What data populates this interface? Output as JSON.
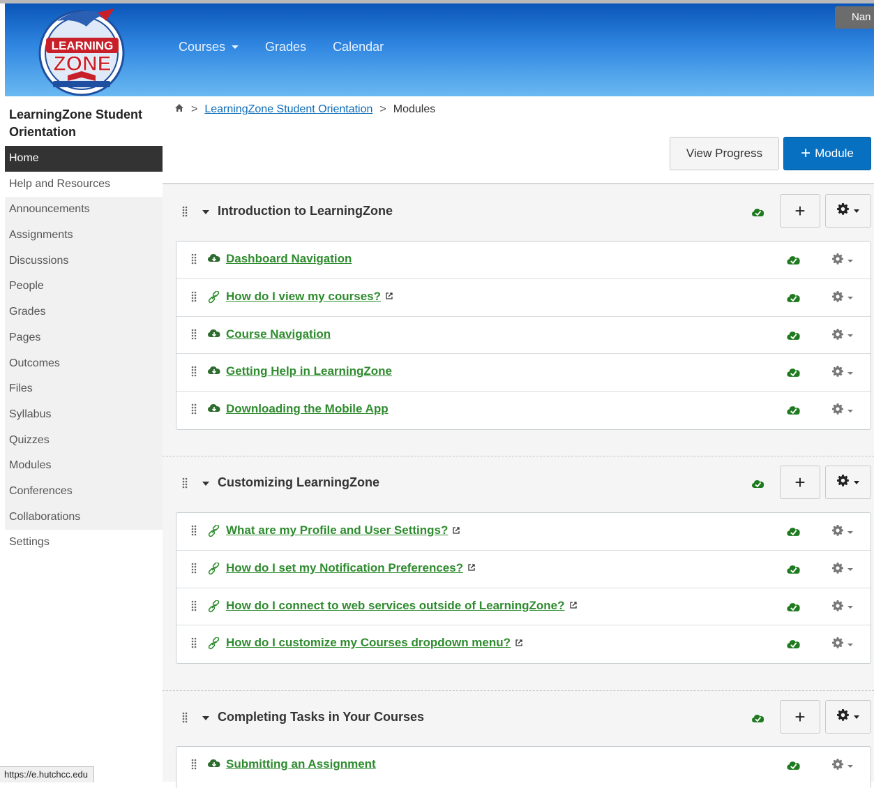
{
  "header": {
    "logo_alt": "LearningZone",
    "nav": [
      {
        "label": "Courses",
        "has_caret": true
      },
      {
        "label": "Grades",
        "has_caret": false
      },
      {
        "label": "Calendar",
        "has_caret": false
      }
    ],
    "user_short": "Nan"
  },
  "sidebar": {
    "course_title": "LearningZone Student Orientation",
    "items": [
      {
        "label": "Home"
      },
      {
        "label": "Help and Resources"
      },
      {
        "label": "Announcements"
      },
      {
        "label": "Assignments"
      },
      {
        "label": "Discussions"
      },
      {
        "label": "People"
      },
      {
        "label": "Grades"
      },
      {
        "label": "Pages"
      },
      {
        "label": "Outcomes"
      },
      {
        "label": "Files"
      },
      {
        "label": "Syllabus"
      },
      {
        "label": "Quizzes"
      },
      {
        "label": "Modules"
      },
      {
        "label": "Conferences"
      },
      {
        "label": "Collaborations"
      },
      {
        "label": "Settings"
      }
    ]
  },
  "breadcrumb": {
    "course": "LearningZone Student Orientation",
    "current": "Modules"
  },
  "actions": {
    "view_progress": "View Progress",
    "add_module": "Module"
  },
  "modules": [
    {
      "title": "Introduction to LearningZone",
      "items": [
        {
          "type": "page",
          "label": "Dashboard Navigation",
          "external": false
        },
        {
          "type": "link",
          "label": "How do I view my courses?",
          "external": true
        },
        {
          "type": "page",
          "label": "Course Navigation",
          "external": false
        },
        {
          "type": "page",
          "label": "Getting Help in LearningZone",
          "external": false
        },
        {
          "type": "page",
          "label": "Downloading the Mobile App",
          "external": false
        }
      ]
    },
    {
      "title": "Customizing LearningZone",
      "items": [
        {
          "type": "link",
          "label": "What are my Profile and User Settings?",
          "external": true
        },
        {
          "type": "link",
          "label": "How do I set my Notification Preferences?",
          "external": true
        },
        {
          "type": "link",
          "label": "How do I connect to web services outside of LearningZone?",
          "external": true
        },
        {
          "type": "link",
          "label": "How do I customize my Courses dropdown menu?",
          "external": true
        }
      ]
    },
    {
      "title": "Completing Tasks in Your Courses",
      "items": [
        {
          "type": "page",
          "label": "Submitting an Assignment",
          "external": false
        }
      ]
    }
  ],
  "status_bar": {
    "url": "https://e.hutchcc.edu"
  },
  "colors": {
    "accent": "#0870c0",
    "link_green": "#2e8b2e",
    "publish_green": "#1f7a1f",
    "sidebar_active": "#333333"
  }
}
